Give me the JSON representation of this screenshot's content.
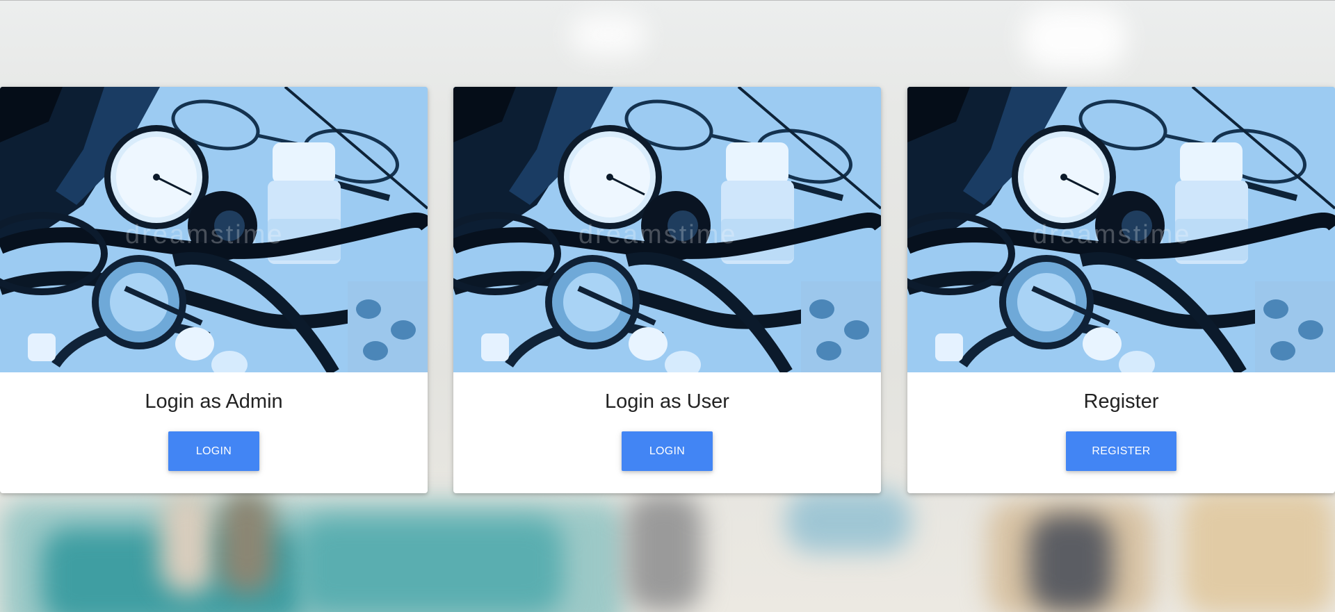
{
  "colors": {
    "button": "#4285f4",
    "card": "#ffffff",
    "title_text": "#222222",
    "photo_tint": "#5aa3e6"
  },
  "cards": [
    {
      "title": "Login as Admin",
      "button_label": "LOGIN",
      "image": "medical-equipment-photo"
    },
    {
      "title": "Login as User",
      "button_label": "LOGIN",
      "image": "medical-equipment-photo"
    },
    {
      "title": "Register",
      "button_label": "REGISTER",
      "image": "medical-equipment-photo"
    }
  ]
}
